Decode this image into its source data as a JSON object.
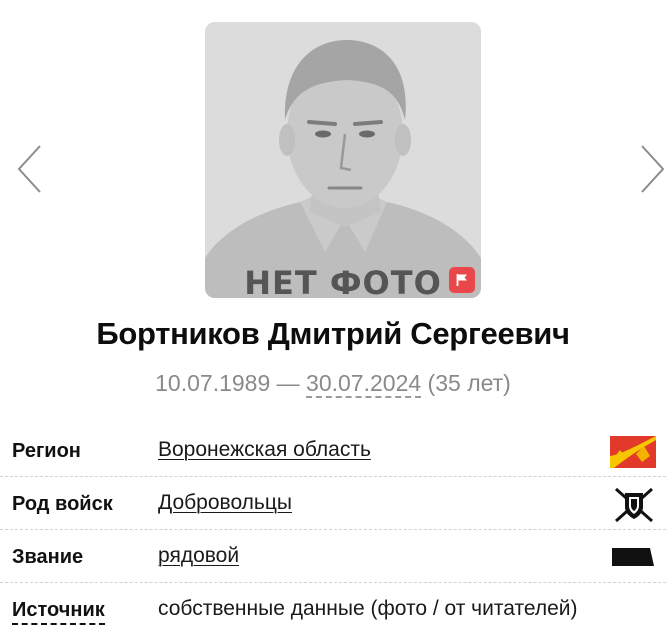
{
  "photo": {
    "caption": "НЕТ ФОТО",
    "placeholder_icon": "silhouette-portrait",
    "report_icon": "flag-icon",
    "report_color": "#e8484a"
  },
  "navigation": {
    "prev_icon": "chevron-left-icon",
    "next_icon": "chevron-right-icon"
  },
  "person": {
    "name": "Бортников Дмитрий Сергеевич",
    "birth_date": "10.07.1989",
    "separator": " — ",
    "death_date": "30.07.2024",
    "age": " (35 лет)"
  },
  "details": [
    {
      "label": "Регион",
      "value": "Воронежская область",
      "icon": "region-flag-icon"
    },
    {
      "label": "Род войск",
      "value": "Добровольцы",
      "icon": "volunteer-emblem-icon"
    },
    {
      "label": "Звание",
      "value": "рядовой",
      "icon": "rank-insignia-icon"
    },
    {
      "label": "Источник",
      "value": "собственные данные (фото / от читателей)",
      "icon": ""
    }
  ]
}
